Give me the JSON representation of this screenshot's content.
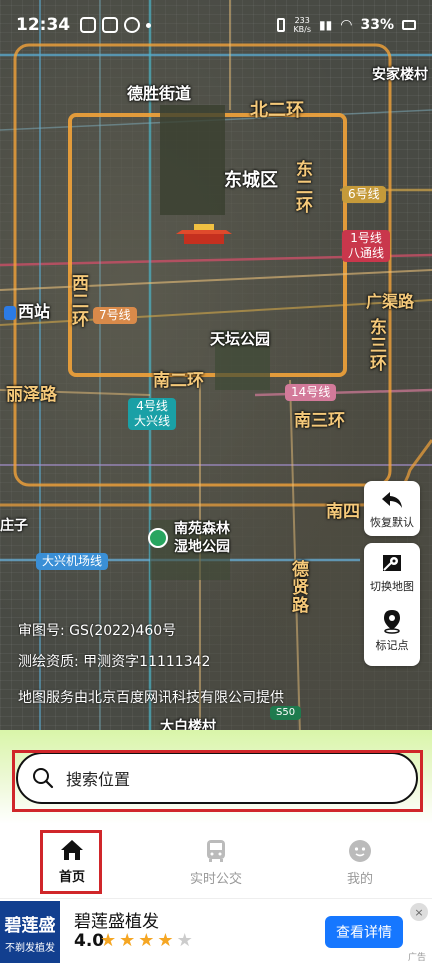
{
  "status_bar": {
    "time": "12:34",
    "net_speed_value": "233",
    "net_speed_unit": "KB/s",
    "battery": "33%"
  },
  "map": {
    "district_labels": {
      "desheng": "德胜街道",
      "dongcheng": "东城区",
      "anjialou": "安家楼村",
      "tiantan": "天坛公园",
      "xizhan": "西站",
      "zhuangzi": "庄子",
      "nanyuan": "南苑森林\n湿地公园",
      "taibai": "大白楼村"
    },
    "road_labels": {
      "north2": "北二环",
      "east2": "东二环",
      "west2": "西二环",
      "south2": "南二环",
      "south3": "南三环",
      "east3": "东三环",
      "guangqu": "广渠路",
      "lize": "丽泽路",
      "dexian": "德贤路",
      "south4": "南四"
    },
    "metro_badges": {
      "line6": "6号线",
      "line1": "1号线\n八通线",
      "line7": "7号线",
      "line4": "4号线\n大兴线",
      "line14": "14号线",
      "daxing_airport": "大兴机场线",
      "s50": "S50"
    },
    "controls": {
      "restore_label": "恢复默认",
      "switch_label": "切换地图",
      "mark_label": "标记点"
    },
    "copyright": {
      "approval": "审图号: GS(2022)460号",
      "survey": "测绘资质: 甲测资字11111342",
      "provider": "地图服务由北京百度网讯科技有限公司提供"
    }
  },
  "search": {
    "placeholder": "搜索位置"
  },
  "tabs": [
    {
      "label": "首页",
      "icon": "home-icon",
      "active": true
    },
    {
      "label": "实时公交",
      "icon": "bus-icon",
      "active": false
    },
    {
      "label": "我的",
      "icon": "profile-icon",
      "active": false
    }
  ],
  "ad": {
    "logo_name": "碧莲盛",
    "logo_slogan": "不剃发植发",
    "title": "碧莲盛植发",
    "rating": "4.0",
    "stars_filled": 4,
    "stars_total": 5,
    "cta": "查看详情",
    "close": "×",
    "mark": "广告"
  },
  "colors": {
    "highlight_frame": "#d0262a",
    "cta_blue": "#1677ff",
    "road_orange": "#f2a33a",
    "metro_blue": "#1a8fd6"
  }
}
